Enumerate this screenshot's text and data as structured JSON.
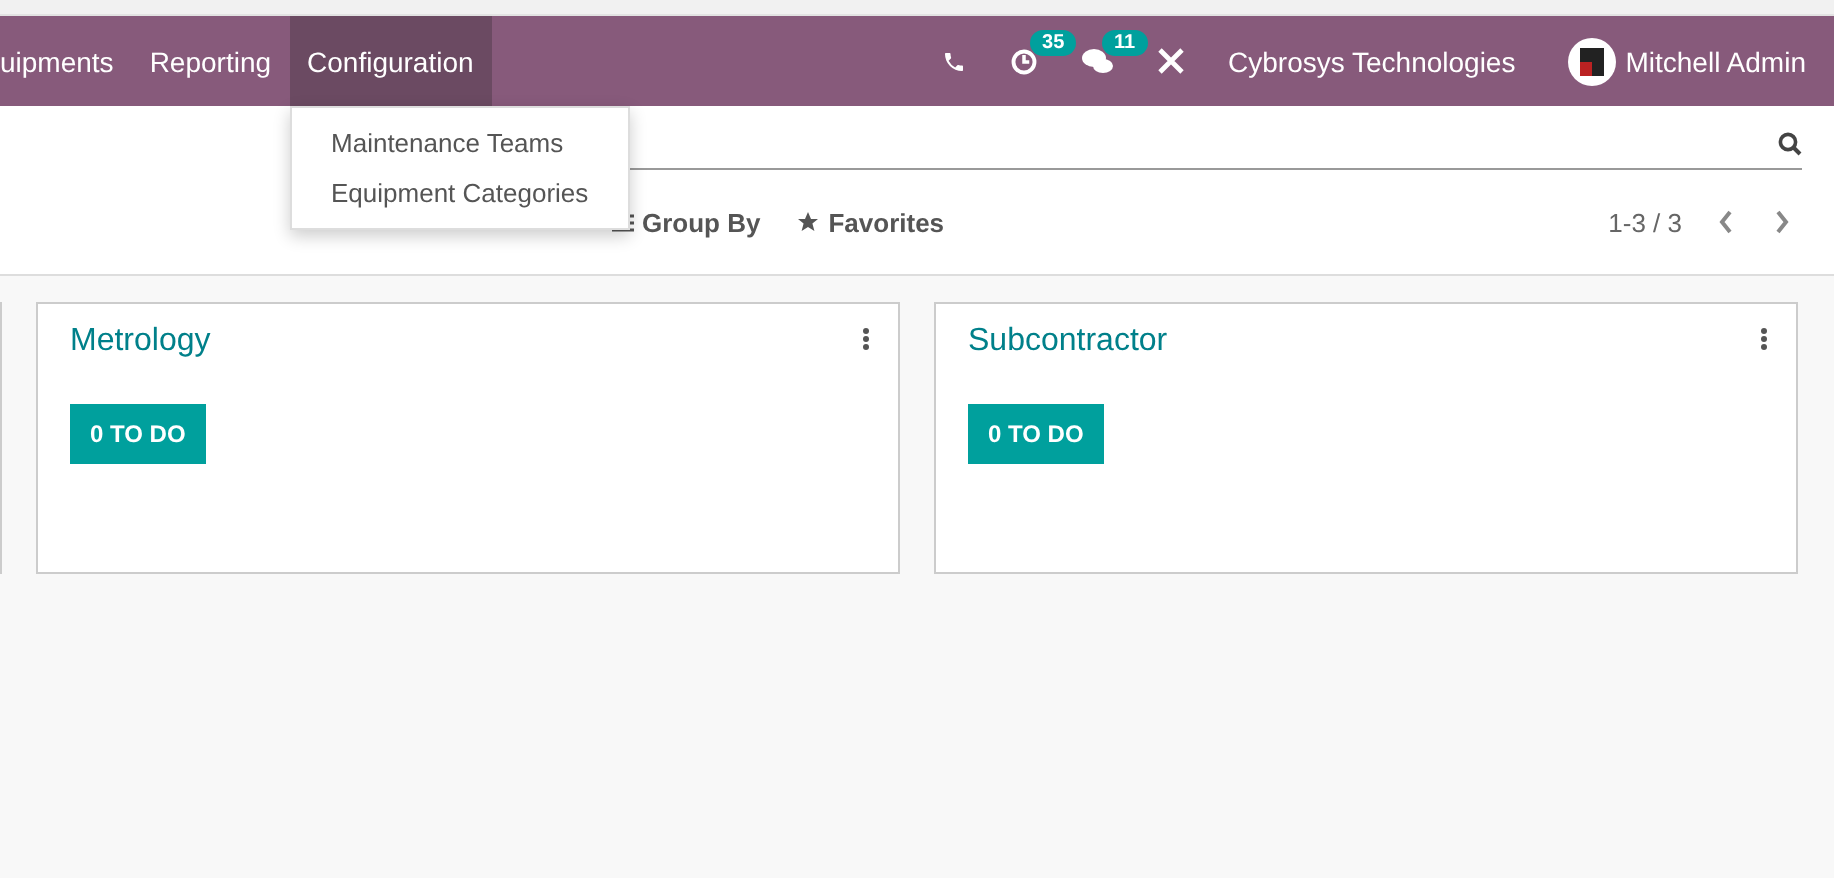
{
  "navbar": {
    "menu": [
      {
        "label": "uipments",
        "selected": false
      },
      {
        "label": "Reporting",
        "selected": false
      },
      {
        "label": "Configuration",
        "selected": true
      }
    ],
    "activity_count": "35",
    "message_count": "11",
    "company": "Cybrosys Technologies",
    "user": "Mitchell Admin"
  },
  "dropdown": {
    "items": [
      "Maintenance Teams",
      "Equipment Categories"
    ]
  },
  "controls": {
    "group_by": "Group By",
    "favorites": "Favorites",
    "pager": "1-3 / 3"
  },
  "cards": [
    {
      "title": "Metrology",
      "todo": "0 TO DO"
    },
    {
      "title": "Subcontractor",
      "todo": "0 TO DO"
    }
  ]
}
